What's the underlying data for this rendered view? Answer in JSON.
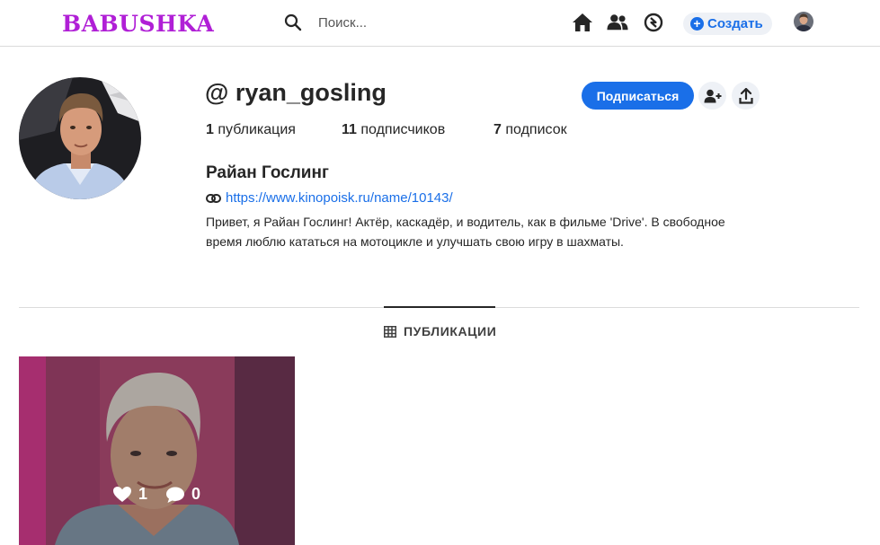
{
  "header": {
    "logo": "BABUSHKA",
    "search_placeholder": "Поиск...",
    "create_label": "Создать",
    "icons": [
      "home-icon",
      "friends-icon",
      "explore-icon"
    ]
  },
  "profile": {
    "username": "@ ryan_gosling",
    "follow_label": "Подписаться",
    "stats": {
      "posts_count": "1",
      "posts_label": "публикация",
      "followers_count": "11",
      "followers_label": "подписчиков",
      "following_count": "7",
      "following_label": "подписок"
    },
    "full_name": "Райан Гослинг",
    "link": "https://www.kinopoisk.ru/name/10143/",
    "bio": "Привет, я Райан Гослинг! Актёр, каскадёр, и водитель, как в фильме 'Drive'. В свободное время люблю кататься на мотоцикле и улучшать свою игру в шахматы."
  },
  "tabs": {
    "publications": "ПУБЛИКАЦИИ"
  },
  "posts": [
    {
      "likes": "1",
      "comments": "0"
    }
  ],
  "colors": {
    "accent": "#1a6fe8",
    "logo": "#b01fd6"
  }
}
